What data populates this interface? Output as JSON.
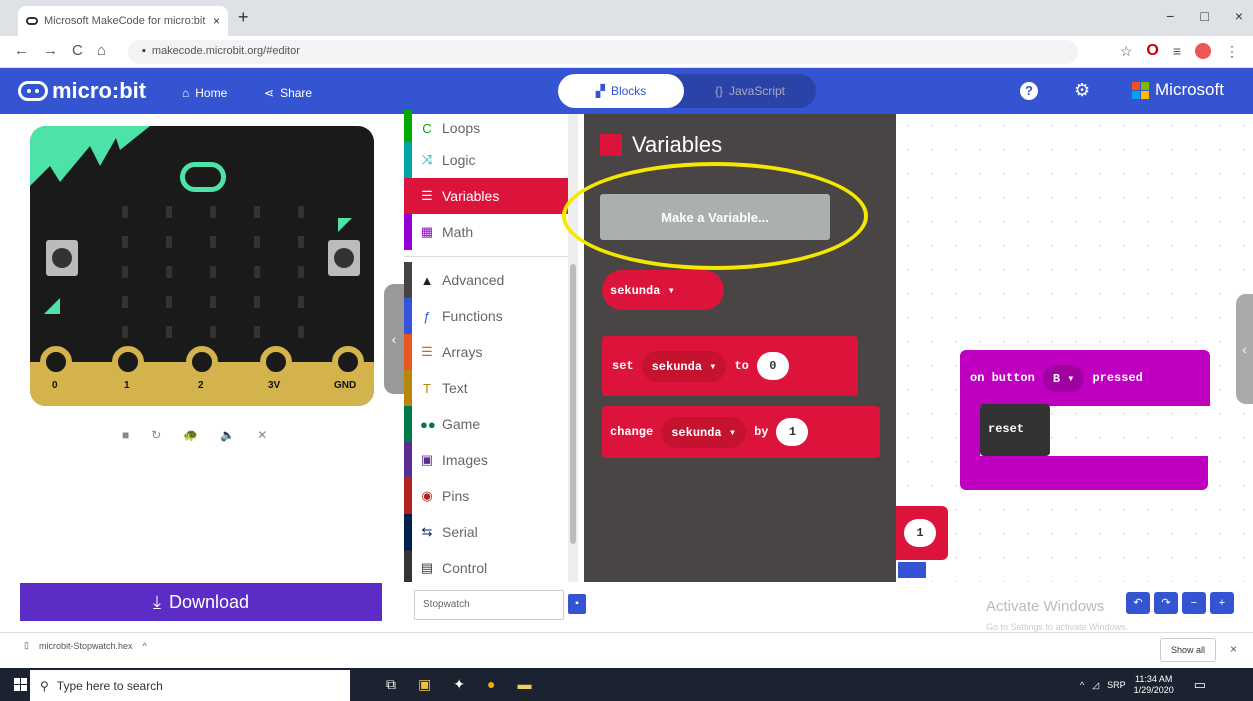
{
  "browser": {
    "tab_title": "Microsoft MakeCode for micro:bit",
    "tab_close": "×",
    "new_tab": "+",
    "url": "makecode.microbit.org/#editor",
    "window_buttons": [
      "−",
      "□",
      "×"
    ]
  },
  "header": {
    "logo_text": "micro:bit",
    "home_label": "Home",
    "share_label": "Share",
    "blocks_label": "Blocks",
    "javascript_label": "JavaScript",
    "brand_label": "Microsoft"
  },
  "simulator": {
    "pins": [
      "0",
      "1",
      "2",
      "3V",
      "GND"
    ],
    "download_label": "Download"
  },
  "toolbox": {
    "categories": [
      {
        "label": "Loops",
        "icon": "loops-icon",
        "color": "#00aa00"
      },
      {
        "label": "Logic",
        "icon": "logic-icon",
        "color": "#00a4a6"
      },
      {
        "label": "Variables",
        "icon": "variables-icon",
        "color": "#dc143c"
      },
      {
        "label": "Math",
        "icon": "math-icon",
        "color": "#9400d3"
      },
      {
        "label": "Advanced",
        "icon": "chevron-up-icon",
        "color": "#444444"
      },
      {
        "label": "Functions",
        "icon": "functions-icon",
        "color": "#3455db"
      },
      {
        "label": "Arrays",
        "icon": "arrays-icon",
        "color": "#e65722"
      },
      {
        "label": "Text",
        "icon": "text-icon",
        "color": "#b8860b"
      },
      {
        "label": "Game",
        "icon": "game-icon",
        "color": "#007a4b"
      },
      {
        "label": "Images",
        "icon": "images-icon",
        "color": "#5c2d91"
      },
      {
        "label": "Pins",
        "icon": "pins-icon",
        "color": "#b22222"
      },
      {
        "label": "Serial",
        "icon": "serial-icon",
        "color": "#002050"
      },
      {
        "label": "Control",
        "icon": "control-icon",
        "color": "#333333"
      }
    ]
  },
  "flyout": {
    "title": "Variables",
    "make_variable_label": "Make a Variable...",
    "variable_name": "sekunda ▾",
    "set_block": {
      "keyword": "set",
      "variable": "sekunda ▾",
      "to": "to",
      "value": "0"
    },
    "change_block": {
      "keyword": "change",
      "variable": "sekunda ▾",
      "by": "by",
      "value": "1"
    }
  },
  "workspace": {
    "stray_value": "1",
    "event_block": {
      "prefix": "on button",
      "button": "B ▾",
      "suffix": "pressed"
    },
    "inner_block": "reset",
    "project_name": "Stopwatch",
    "activate_title": "Activate Windows",
    "activate_sub": "Go to Settings to activate Windows."
  },
  "shelf": {
    "file_name": "microbit-Stopwatch.hex",
    "show_all": "Show all",
    "close": "×"
  },
  "taskbar": {
    "search_placeholder": "Type here to search",
    "time": "11:34 AM",
    "date": "1/29/2020",
    "lang": "SRP"
  }
}
